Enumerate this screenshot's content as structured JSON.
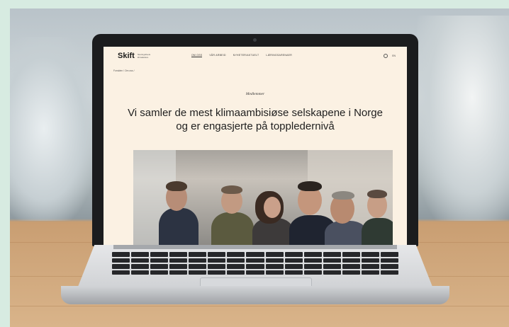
{
  "site": {
    "logo": "Skift",
    "logo_sub": "Næringslivets klimaledere",
    "nav": [
      {
        "label": "OM OSS",
        "active": true
      },
      {
        "label": "VÅR ARBEID",
        "active": false
      },
      {
        "label": "NYHETER/AKTUELT",
        "active": false
      },
      {
        "label": "LÆRINGSARENAER",
        "active": false
      }
    ],
    "lang": "EN",
    "breadcrumb": "Forsiden / Om oss /",
    "kicker": "Medlemmer",
    "headline_line1": "Vi samler de mest klimaambisiøse selskapene i Norge",
    "headline_line2": "og er engasjerte på toppledernivå"
  },
  "colors": {
    "page_bg": "#d7ebe1",
    "screen_bg": "#fbf1e3",
    "laptop_bezel": "#1b1c1e",
    "laptop_body": "#d2d4d7",
    "table_wood": "#d9b48a"
  }
}
